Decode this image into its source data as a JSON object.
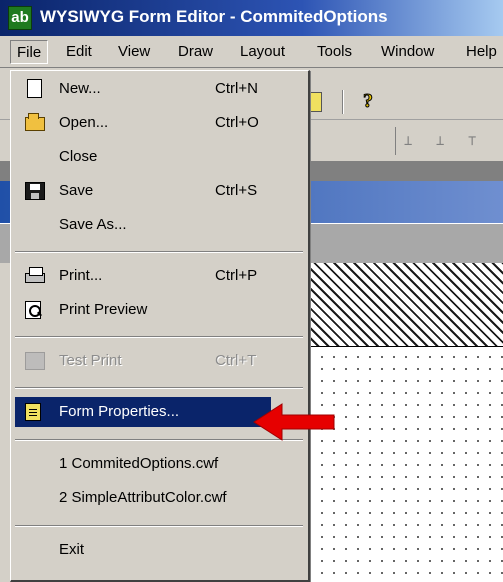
{
  "window": {
    "title": "WYSIWYG Form Editor - CommitedOptions",
    "icon": "form-editor-app-icon",
    "icon_text": "ab"
  },
  "menubar": {
    "items": [
      {
        "label": "File",
        "active": true
      },
      {
        "label": "Edit"
      },
      {
        "label": "View"
      },
      {
        "label": "Draw"
      },
      {
        "label": "Layout"
      },
      {
        "label": "Tools"
      },
      {
        "label": "Window"
      },
      {
        "label": "Help"
      }
    ]
  },
  "file_menu": {
    "items": [
      {
        "label": "New...",
        "shortcut": "Ctrl+N",
        "icon": "new-document-icon"
      },
      {
        "label": "Open...",
        "shortcut": "Ctrl+O",
        "icon": "open-folder-icon"
      },
      {
        "label": "Close"
      },
      {
        "label": "Save",
        "shortcut": "Ctrl+S",
        "icon": "save-disk-icon"
      },
      {
        "label": "Save As..."
      },
      {
        "label": "Print...",
        "shortcut": "Ctrl+P",
        "icon": "printer-icon"
      },
      {
        "label": "Print Preview",
        "icon": "print-preview-icon"
      },
      {
        "label": "Test Print",
        "shortcut": "Ctrl+T",
        "icon": "test-print-icon",
        "disabled": true
      },
      {
        "label": "Form Properties...",
        "icon": "form-properties-icon",
        "selected": true
      },
      {
        "label": "1 CommitedOptions.cwf"
      },
      {
        "label": "2 SimpleAttributColor.cwf"
      },
      {
        "label": "Exit"
      }
    ]
  },
  "colors": {
    "title_bar": "#0a246a",
    "selection": "#0a246a",
    "menu_bg": "#d4d0c8",
    "arrow": "#e60000"
  }
}
